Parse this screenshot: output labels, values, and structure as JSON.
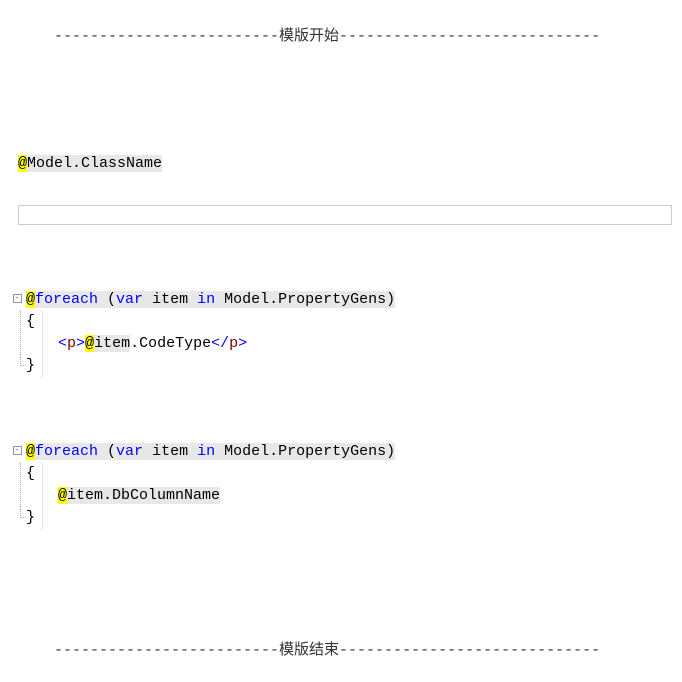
{
  "header": {
    "text": "-------------------------模版开始-----------------------------"
  },
  "footer": {
    "text": "-------------------------模版结束-----------------------------"
  },
  "section1": {
    "at": "@",
    "model": "Model.ClassName"
  },
  "section2": {
    "at": "@",
    "foreach": "foreach",
    "paren_open": " (",
    "var": "var",
    "item_in": " item ",
    "in": "in",
    "rest": " Model.PropertyGens)",
    "brace_open": "{",
    "brace_close": "}",
    "tag_open": "<",
    "tag_p": "p",
    "tag_close_gt": ">",
    "inner_at": "@",
    "inner_item": "item",
    "inner_dot": ".CodeType",
    "tag_close_open": "</",
    "tag_close_p": "p",
    "tag_final": ">"
  },
  "section3": {
    "at": "@",
    "foreach": "foreach",
    "paren_open": " (",
    "var": "var",
    "item_in": " item ",
    "in": "in",
    "rest": " Model.PropertyGens)",
    "brace_open": "{",
    "brace_close": "}",
    "inner_at": "@",
    "inner_item": "item",
    "inner_dot": ".DbColumnName"
  }
}
